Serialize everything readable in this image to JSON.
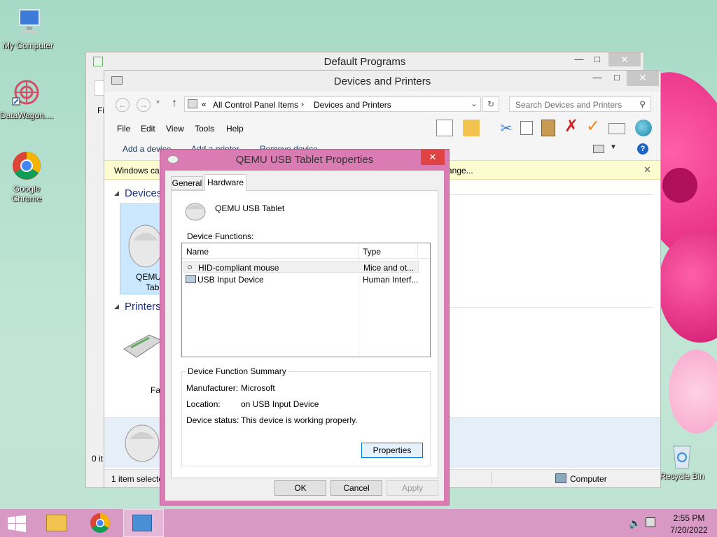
{
  "desktop": {
    "icons": [
      {
        "label": "My Computer",
        "icon": "computer-icon"
      },
      {
        "label": "DataWagon....",
        "icon": "datawagon-icon"
      },
      {
        "label": "Google Chrome",
        "icon": "chrome-icon"
      },
      {
        "label": "Recycle Bin",
        "icon": "recycle-bin-icon"
      }
    ]
  },
  "default_programs": {
    "title": "Default Programs",
    "side_text": "Fi",
    "status": "0 it"
  },
  "devices_window": {
    "title": "Devices and Printers",
    "address": {
      "prefix": "«",
      "crumb1": "All Control Panel Items",
      "sep": "›",
      "crumb2": "Devices and Printers"
    },
    "search_placeholder": "Search Devices and Printers",
    "menu": [
      "File",
      "Edit",
      "View",
      "Tools",
      "Help"
    ],
    "commands": [
      "Add a device",
      "Add a printer",
      "Remove device"
    ],
    "infobar_left": "Windows ca",
    "infobar_right": "ange...",
    "section_devices": "Devices",
    "section_printers": "Printers",
    "device_label_1": "QEMU",
    "device_label_2": "Tabl",
    "printer_label": "Fax",
    "status_left": "1 item selecte",
    "status_right": "Computer"
  },
  "dialog": {
    "title": "QEMU USB Tablet Properties",
    "tabs": [
      "General",
      "Hardware"
    ],
    "device_name": "QEMU USB Tablet",
    "functions_label": "Device Functions:",
    "columns": [
      "Name",
      "Type"
    ],
    "rows": [
      {
        "name": "HID-compliant mouse",
        "type": "Mice and ot..."
      },
      {
        "name": "USB Input Device",
        "type": "Human Interf..."
      }
    ],
    "summary_title": "Device Function Summary",
    "manufacturer_label": "Manufacturer:",
    "manufacturer": "Microsoft",
    "location_label": "Location:",
    "location": "on USB Input Device",
    "status_label": "Device status:",
    "status": "This device is working properly.",
    "properties_btn": "Properties",
    "ok": "OK",
    "cancel": "Cancel",
    "apply": "Apply"
  },
  "taskbar": {
    "time": "2:55 PM",
    "date": "7/20/2022"
  },
  "colors": {
    "accent": "#db7bb4",
    "close_red": "#e04343",
    "taskbar": "#d89ac4"
  }
}
